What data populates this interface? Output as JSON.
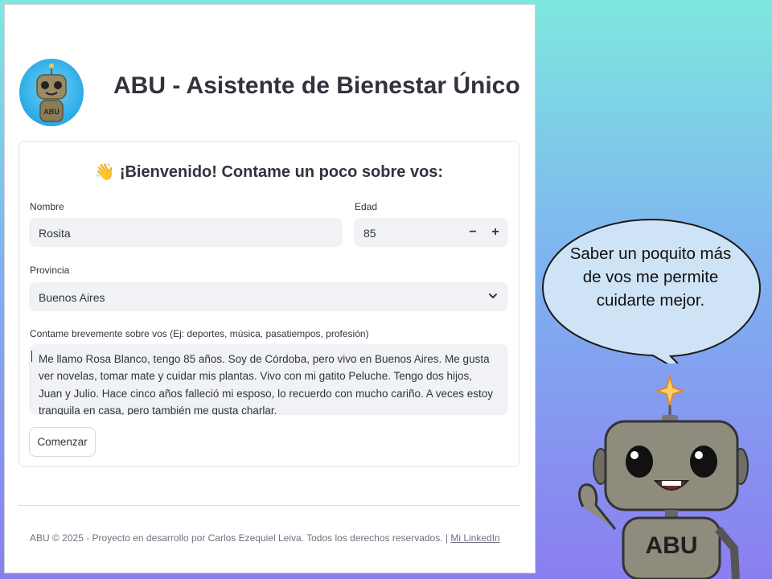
{
  "app": {
    "title": "ABU - Asistente de Bienestar Único",
    "logo_badge": "ABU"
  },
  "form": {
    "heading_emoji": "👋",
    "heading": "¡Bienvenido! Contame un poco sobre vos:",
    "name": {
      "label": "Nombre",
      "value": "Rosita"
    },
    "age": {
      "label": "Edad",
      "value": "85",
      "decrement": "−",
      "increment": "+"
    },
    "province": {
      "label": "Provincia",
      "selected": "Buenos Aires"
    },
    "about": {
      "label": "Contame brevemente sobre vos (Ej: deportes, música, pasatiempos, profesión)",
      "value": "Me llamo Rosa Blanco, tengo 85 años. Soy de Córdoba, pero vivo en Buenos Aires. Me gusta ver novelas, tomar mate y cuidar mis plantas. Vivo con mi gatito Peluche. Tengo dos hijos, Juan y Julio. Hace cinco años falleció mi esposo, lo recuerdo con mucho cariño. A veces estoy tranquila en casa, pero también me gusta charlar."
    },
    "submit_label": "Comenzar"
  },
  "footer": {
    "text": "ABU © 2025 - Proyecto en desarrollo por Carlos Ezequiel Leiva. Todos los derechos reservados. | ",
    "link_label": "Mi LinkedIn"
  },
  "mascot": {
    "speech": "Saber un poquito más de vos me permite cuidarte mejor.",
    "badge": "ABU"
  },
  "colors": {
    "field_bg": "#f0f2f6",
    "text": "#31333f",
    "robot_body": "#8f8c7e",
    "bg_top": "#7ee8df",
    "bg_bottom": "#8b7ef0"
  }
}
